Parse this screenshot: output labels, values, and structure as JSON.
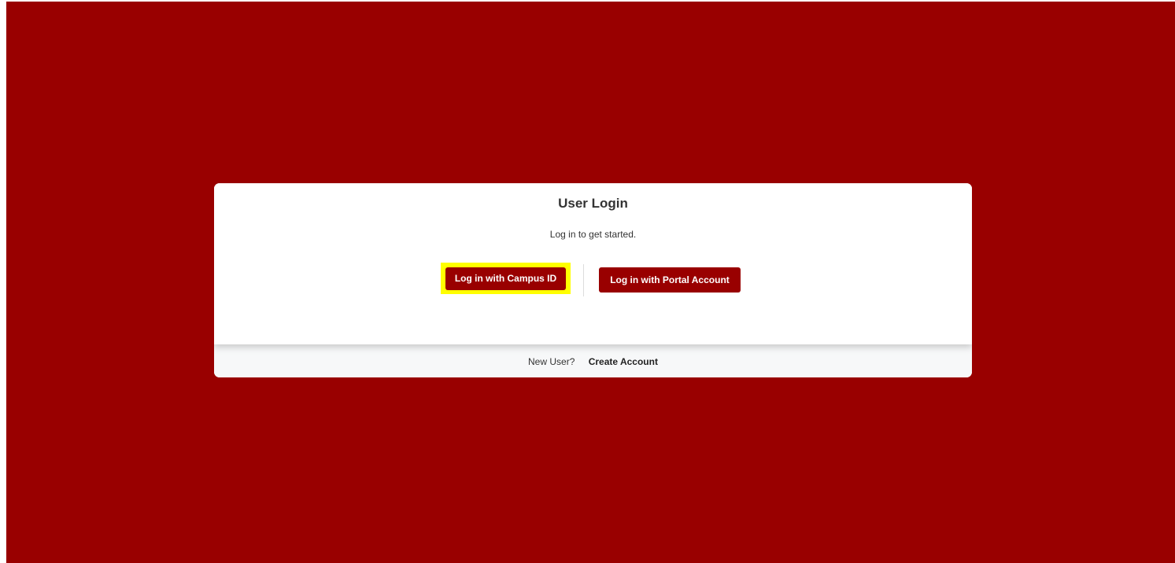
{
  "login": {
    "title": "User Login",
    "subtitle": "Log in to get started.",
    "campus_button": "Log in with Campus ID",
    "portal_button": "Log in with Portal Account"
  },
  "footer": {
    "new_user_text": "New User?",
    "create_account_link": "Create Account"
  },
  "colors": {
    "background": "#990000",
    "button": "#990000",
    "highlight": "#ffff00",
    "arrow": "#c00000"
  },
  "annotation": {
    "arrow_icon": "right-arrow-icon",
    "highlight_target": "campus-id-button"
  }
}
